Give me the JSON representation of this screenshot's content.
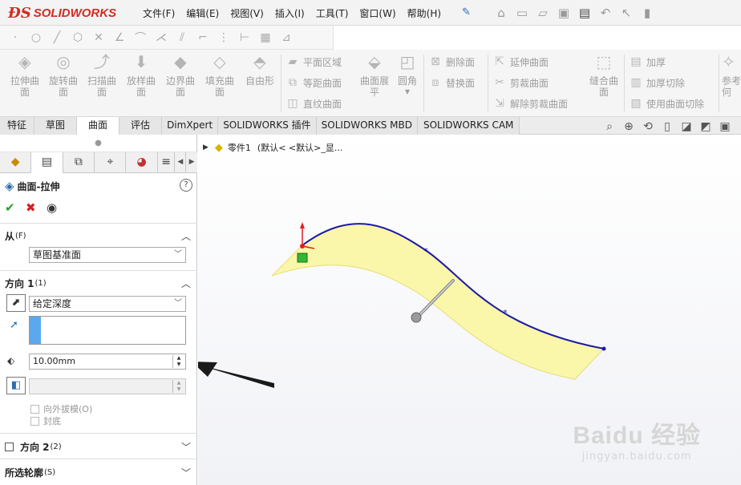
{
  "app": {
    "logo_ds": "ĐS",
    "logo_name": "SOLIDWORKS"
  },
  "menu": [
    "文件(F)",
    "编辑(E)",
    "视图(V)",
    "插入(I)",
    "工具(T)",
    "窗口(W)",
    "帮助(H)"
  ],
  "quick_access_icons": [
    "home-icon",
    "new-icon",
    "open-icon",
    "save-icon",
    "print-icon",
    "undo-icon",
    "select-icon",
    "rebuild-icon"
  ],
  "sketch_icons": [
    "point-icon",
    "circle-icon",
    "line-icon",
    "polygon-icon",
    "trim-icon",
    "angle-icon",
    "fillet-icon",
    "offset-icon",
    "corner-icon",
    "dotted-icon",
    "dimension-icon",
    "grid-icon",
    "angle-dim-icon"
  ],
  "commands": {
    "extrude_surface": "拉伸曲\n面",
    "revolve_surface": "旋转曲\n面",
    "sweep_surface": "扫描曲\n面",
    "loft_surface": "放样曲\n面",
    "boundary_surface": "边界曲\n面",
    "fill_surface": "填充曲\n面",
    "freeform": "自由形",
    "planar_region": "平面区域",
    "offset_surface": "等距曲面",
    "ruled_surface": "直纹曲面",
    "surface_flatten": "曲面展\n平",
    "fillet": "圆角",
    "delete_face": "删除面",
    "replace_face": "替换面",
    "extend_surface": "延伸曲面",
    "trim_surface": "剪裁曲面",
    "untrim_surface": "解除剪裁曲面",
    "knit_surface": "缝合曲\n面",
    "thicken": "加厚",
    "thicken_cut": "加厚切除",
    "cut_with_surface": "使用曲面切除",
    "reference": "参考\n何"
  },
  "tabs": [
    "特征",
    "草图",
    "曲面",
    "评估",
    "DimXpert",
    "SOLIDWORKS 插件",
    "SOLIDWORKS MBD",
    "SOLIDWORKS CAM"
  ],
  "active_tab": "曲面",
  "property_manager": {
    "title": "曲面-拉伸",
    "from_group": {
      "label": "从",
      "sub": "(F)",
      "value": "草图基准面"
    },
    "direction1_group": {
      "label": "方向 1",
      "sub": "(1)",
      "end_condition": "给定深度",
      "depth": "10.00mm",
      "draft": "向外拔模(O)",
      "cap": "封底"
    },
    "direction2_group": {
      "label": "方向 2",
      "sub": "(2)"
    },
    "contours_group": {
      "label": "所选轮廓",
      "sub": "(S)"
    }
  },
  "tree": {
    "part": "零件1",
    "config": "(默认< <默认>_显..."
  },
  "watermark": {
    "brand": "Baidu 经验",
    "url": "jingyan.baidu.com"
  },
  "colors": {
    "surface_fill": "#fbf6a6",
    "curve": "#1b1aa8",
    "origin_red": "#e02020",
    "brand_red": "#d42b22"
  }
}
